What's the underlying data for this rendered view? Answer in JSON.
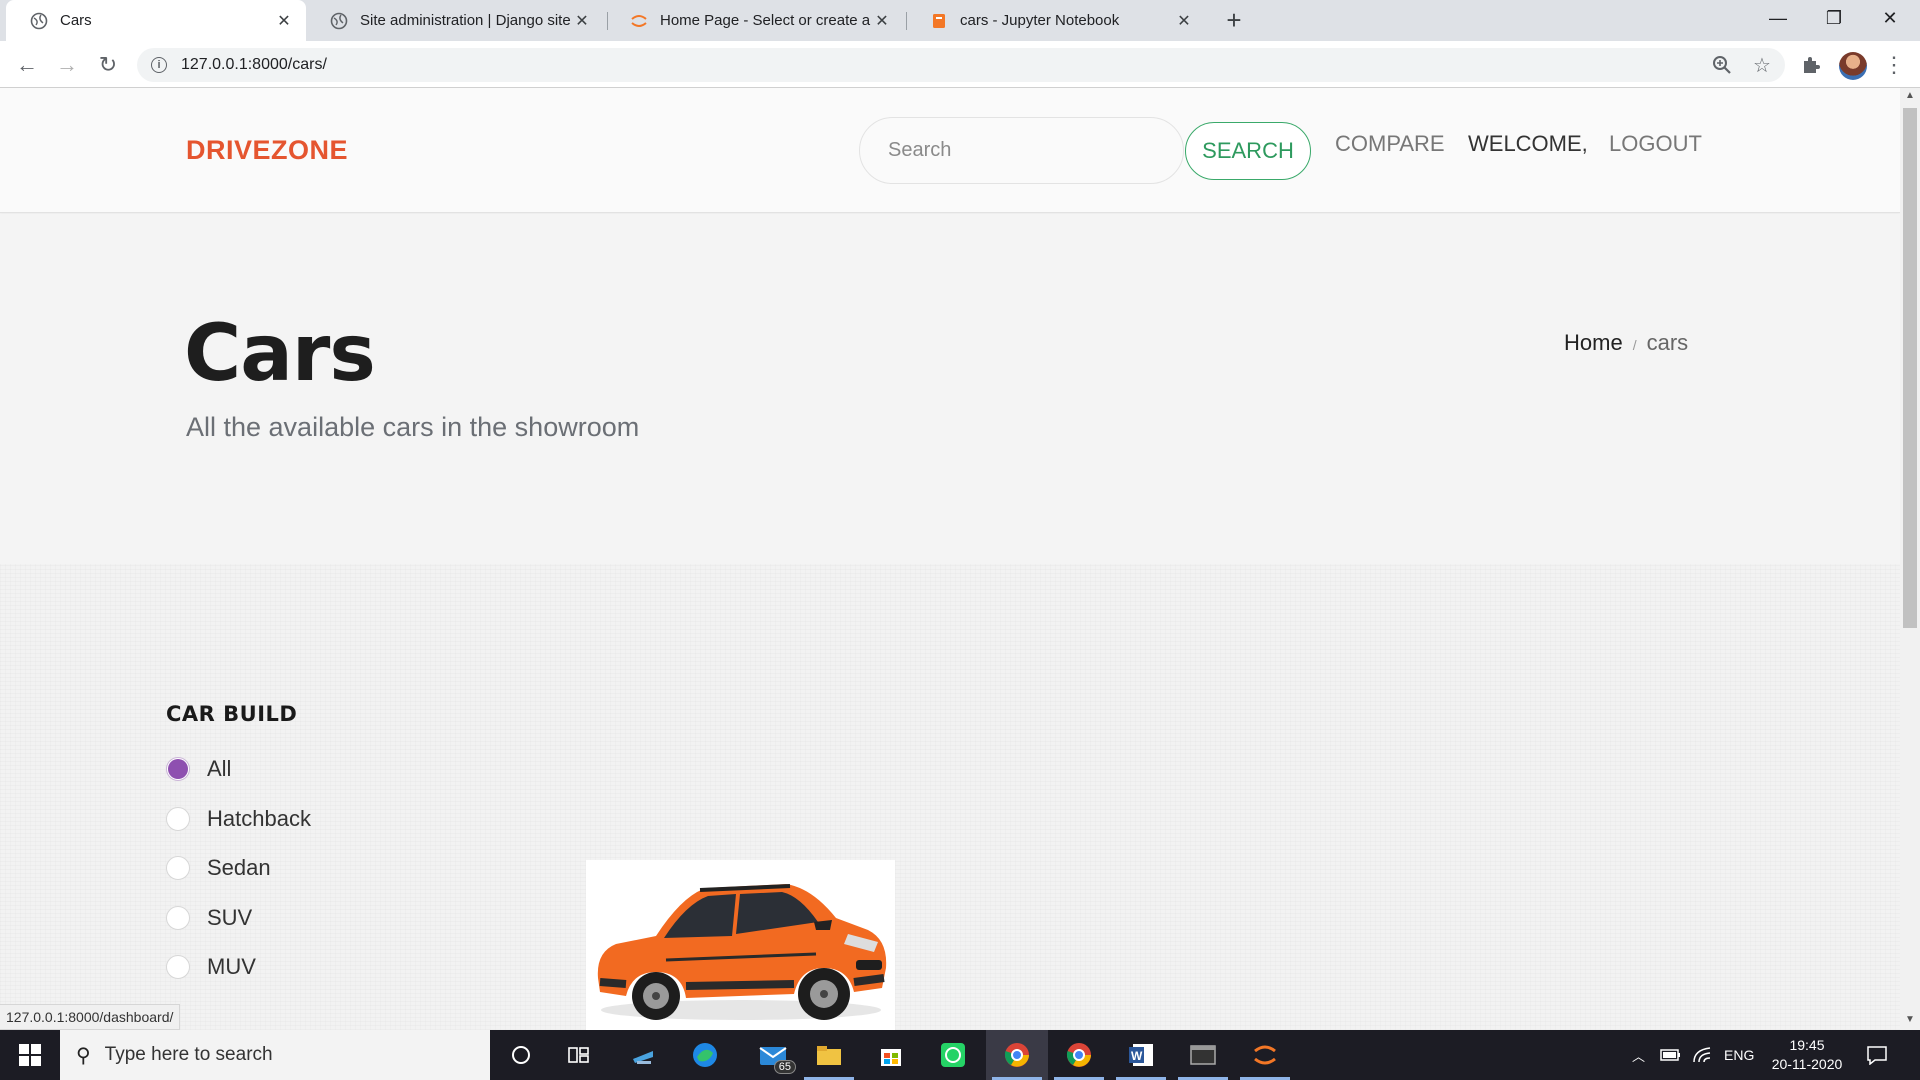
{
  "browser": {
    "tabs": [
      {
        "title": "Cars",
        "active": true
      },
      {
        "title": "Site administration | Django site admin",
        "active": false
      },
      {
        "title": "Home Page - Select or create a notebook",
        "active": false
      },
      {
        "title": "cars - Jupyter Notebook",
        "active": false
      }
    ],
    "url": "127.0.0.1:8000/cars/",
    "status_url": "127.0.0.1:8000/dashboard/"
  },
  "site": {
    "brand": "DRIVEZONE",
    "search_placeholder": "Search",
    "search_button": "SEARCH",
    "nav": {
      "compare": "COMPARE",
      "welcome": "WELCOME,",
      "logout": "LOGOUT"
    }
  },
  "hero": {
    "title": "Cars",
    "subtitle": "All the available cars in the showroom",
    "breadcrumb": {
      "home": "Home",
      "separator": "/",
      "current": "cars"
    }
  },
  "filters": {
    "title": "CAR BUILD",
    "options": [
      {
        "label": "All",
        "checked": true
      },
      {
        "label": "Hatchback",
        "checked": false
      },
      {
        "label": "Sedan",
        "checked": false
      },
      {
        "label": "SUV",
        "checked": false
      },
      {
        "label": "MUV",
        "checked": false
      }
    ]
  },
  "colors": {
    "brand": "#e5552f",
    "search_accent": "#2e9a5e",
    "radio_checked": "#8e4fb0",
    "car_body": "#f26a21"
  },
  "taskbar": {
    "search_placeholder": "Type here to search",
    "mail_badge": "65",
    "language": "ENG",
    "time": "19:45",
    "date": "20-11-2020"
  }
}
